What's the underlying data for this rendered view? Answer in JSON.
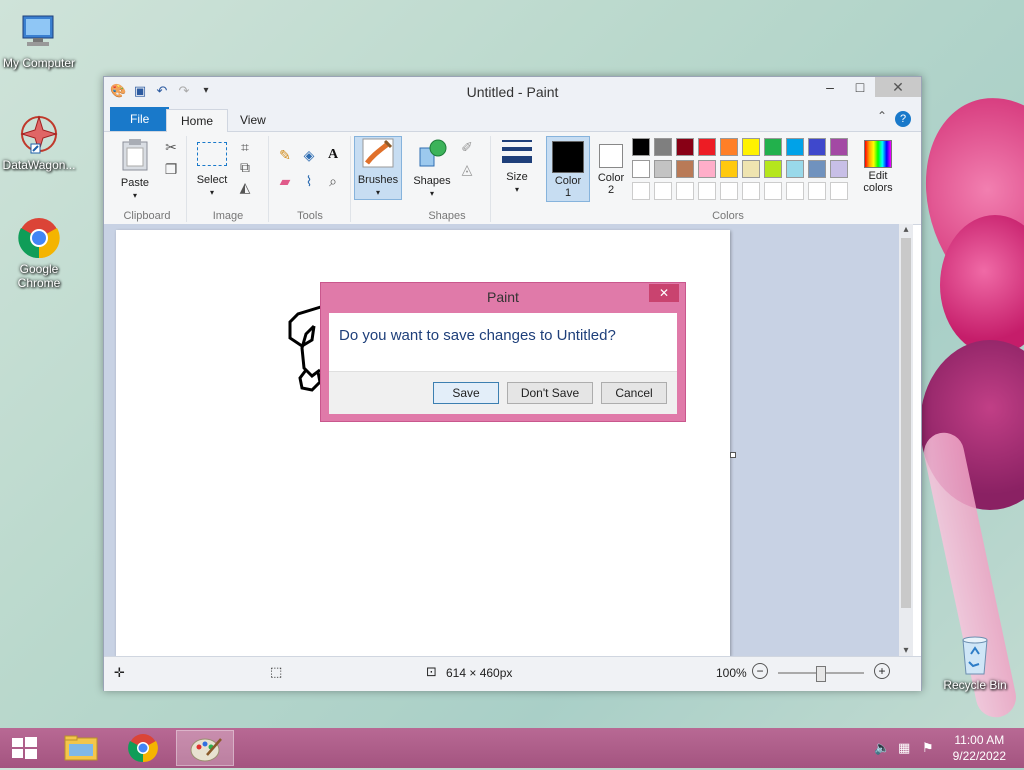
{
  "desktop": {
    "icons": [
      {
        "label": "My Computer"
      },
      {
        "label": "DataWagon..."
      },
      {
        "label": "Google Chrome"
      },
      {
        "label": "Recycle Bin"
      }
    ]
  },
  "window": {
    "title": "Untitled - Paint",
    "tabs": {
      "file": "File",
      "home": "Home",
      "view": "View"
    }
  },
  "ribbon": {
    "clipboard": {
      "group": "Clipboard",
      "paste": "Paste"
    },
    "image": {
      "group": "Image",
      "select": "Select"
    },
    "tools": {
      "group": "Tools"
    },
    "brushes": {
      "label": "Brushes"
    },
    "shapes": {
      "group": "Shapes",
      "label": "Shapes"
    },
    "size": {
      "label": "Size"
    },
    "colors": {
      "group": "Colors",
      "color1_a": "Color",
      "color1_b": "1",
      "color2_a": "Color",
      "color2_b": "2",
      "edit_a": "Edit",
      "edit_b": "colors",
      "palette_row1": [
        "#000000",
        "#7f7f7f",
        "#880015",
        "#ed1c24",
        "#ff7f27",
        "#fff200",
        "#22b14c",
        "#00a2e8",
        "#3f48cc",
        "#a349a4"
      ],
      "palette_row2": [
        "#ffffff",
        "#c3c3c3",
        "#b97a57",
        "#ffaec9",
        "#ffc90e",
        "#efe4b0",
        "#b5e61d",
        "#99d9ea",
        "#7092be",
        "#c8bfe7"
      ]
    }
  },
  "status": {
    "dimensions": "614 × 460px",
    "zoom": "100%"
  },
  "dialog": {
    "title": "Paint",
    "message": "Do you want to save changes to Untitled?",
    "save": "Save",
    "dont_save": "Don't Save",
    "cancel": "Cancel"
  },
  "taskbar": {
    "time": "11:00 AM",
    "date": "9/22/2022"
  }
}
